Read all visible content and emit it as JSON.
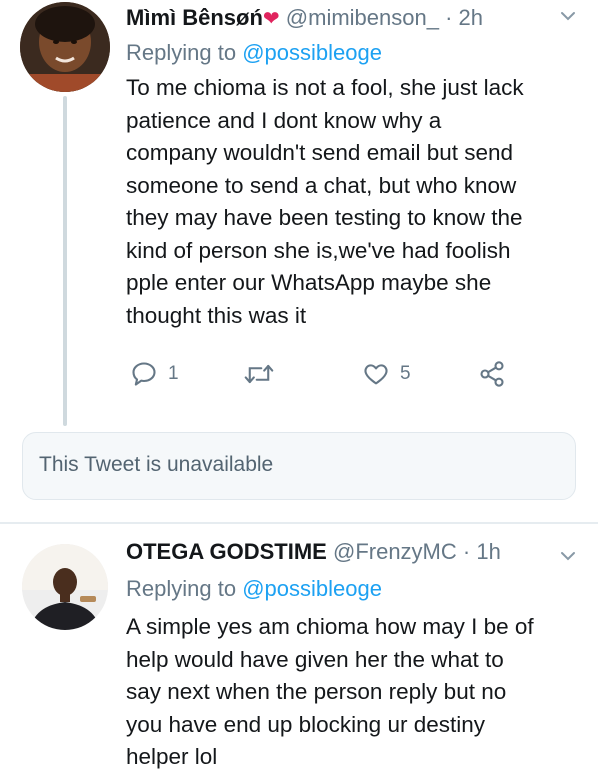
{
  "tweets": [
    {
      "author": {
        "name": "Mìmì Bênsøń",
        "badge": "❤",
        "handle": "@mimibenson_",
        "time": "· 2h"
      },
      "replying_prefix": "Replying to ",
      "replying_to": "@possibleoge",
      "lines": [
        "To me chioma is not a fool, she just lack",
        "patience and I dont know why a",
        "company wouldn't send email but send",
        "someone to send a chat, but who know",
        "they may have been testing to know the",
        "kind of person she is,we've had foolish",
        "pple enter our WhatsApp maybe she",
        "thought this was it"
      ],
      "actions": {
        "replies": "1",
        "likes": "5"
      },
      "quoted_text": "This Tweet is unavailable"
    },
    {
      "author": {
        "name": "OTEGA GODSTIME",
        "handle": "@FrenzyMC",
        "time": "· 1h"
      },
      "replying_prefix": "Replying to ",
      "replying_to": "@possibleoge",
      "lines": [
        "A simple yes am chioma how may I be of",
        "help would have given her the what to",
        "say next when the person reply but no",
        "you have end up blocking ur destiny",
        "helper lol"
      ]
    }
  ],
  "colors": {
    "text": "#14171a",
    "secondary": "#657786",
    "link": "#1da1f2",
    "heart": "#e0245e",
    "divider": "#e6ecf0"
  },
  "icons": [
    "reply-icon",
    "retweet-icon",
    "like-icon",
    "share-icon",
    "chevron-down-icon"
  ]
}
